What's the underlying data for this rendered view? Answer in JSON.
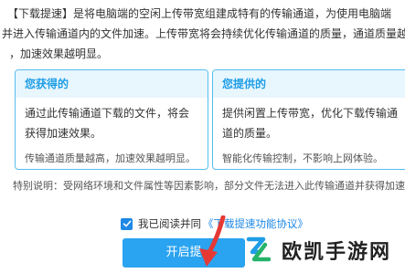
{
  "intro": {
    "line1_tag": "【下载提速】",
    "line1_rest": "是将电脑端的空闲上传带宽组建成特有的传输通道，为使用电脑端",
    "line2": "并进入传输通道内的文件加速。上传带宽将会持续优化传输通道的质量，通道质量越",
    "line3": "，加速效果越明显。"
  },
  "card_left": {
    "title": "您获得的",
    "body": "通过此传输通道下载的文件，将会获得加速效果。",
    "note": "传输通道质量越高，加速效果越明显。"
  },
  "card_right": {
    "title": "您提供的",
    "body": "提供闲置上传带宽，优化下载传输通道的质量。",
    "note": "智能化传输控制，不影响上网体验。"
  },
  "special_note": "特别说明：受网络环境和文件属性等因素影响，部分文件无法进入此传输通道并获得加速",
  "agreement": {
    "label": "我已阅读并同",
    "link": "《下载提速功能协议》",
    "checked": true
  },
  "start_button": {
    "label": "开启提"
  },
  "watermark": {
    "text": "欧凯手游网"
  },
  "colors": {
    "accent": "#2aa3f0",
    "card_border": "#56bdf0",
    "card_header_bg": "#e8f6fd",
    "link": "#1e88e5",
    "arrow": "#e53935"
  }
}
